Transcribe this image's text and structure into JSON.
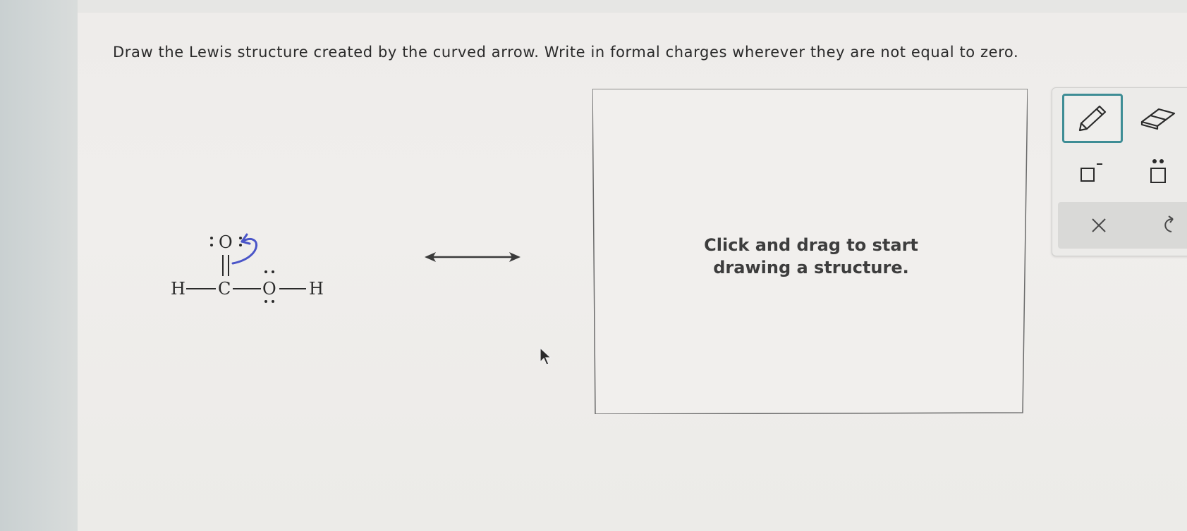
{
  "question": {
    "text": "Draw the Lewis structure created by the curved arrow. Write in formal charges wherever they are not equal to zero."
  },
  "molecule": {
    "atoms": {
      "carbonyl_o": "O",
      "h_left": "H",
      "carbon": "C",
      "hydroxyl_o": "O",
      "h_right": "H"
    }
  },
  "canvas": {
    "hint_line1": "Click and drag to start",
    "hint_line2": "drawing a structure."
  },
  "toolbar": {
    "tools": [
      "pencil-icon",
      "eraser-icon",
      "charge-icon",
      "lone-pair-icon",
      "close-icon",
      "undo-icon"
    ],
    "active_tool": "pencil",
    "active_color": "#3e8d95"
  },
  "colors": {
    "curved_arrow": "#4a55c8",
    "text": "#2a2a2a"
  }
}
